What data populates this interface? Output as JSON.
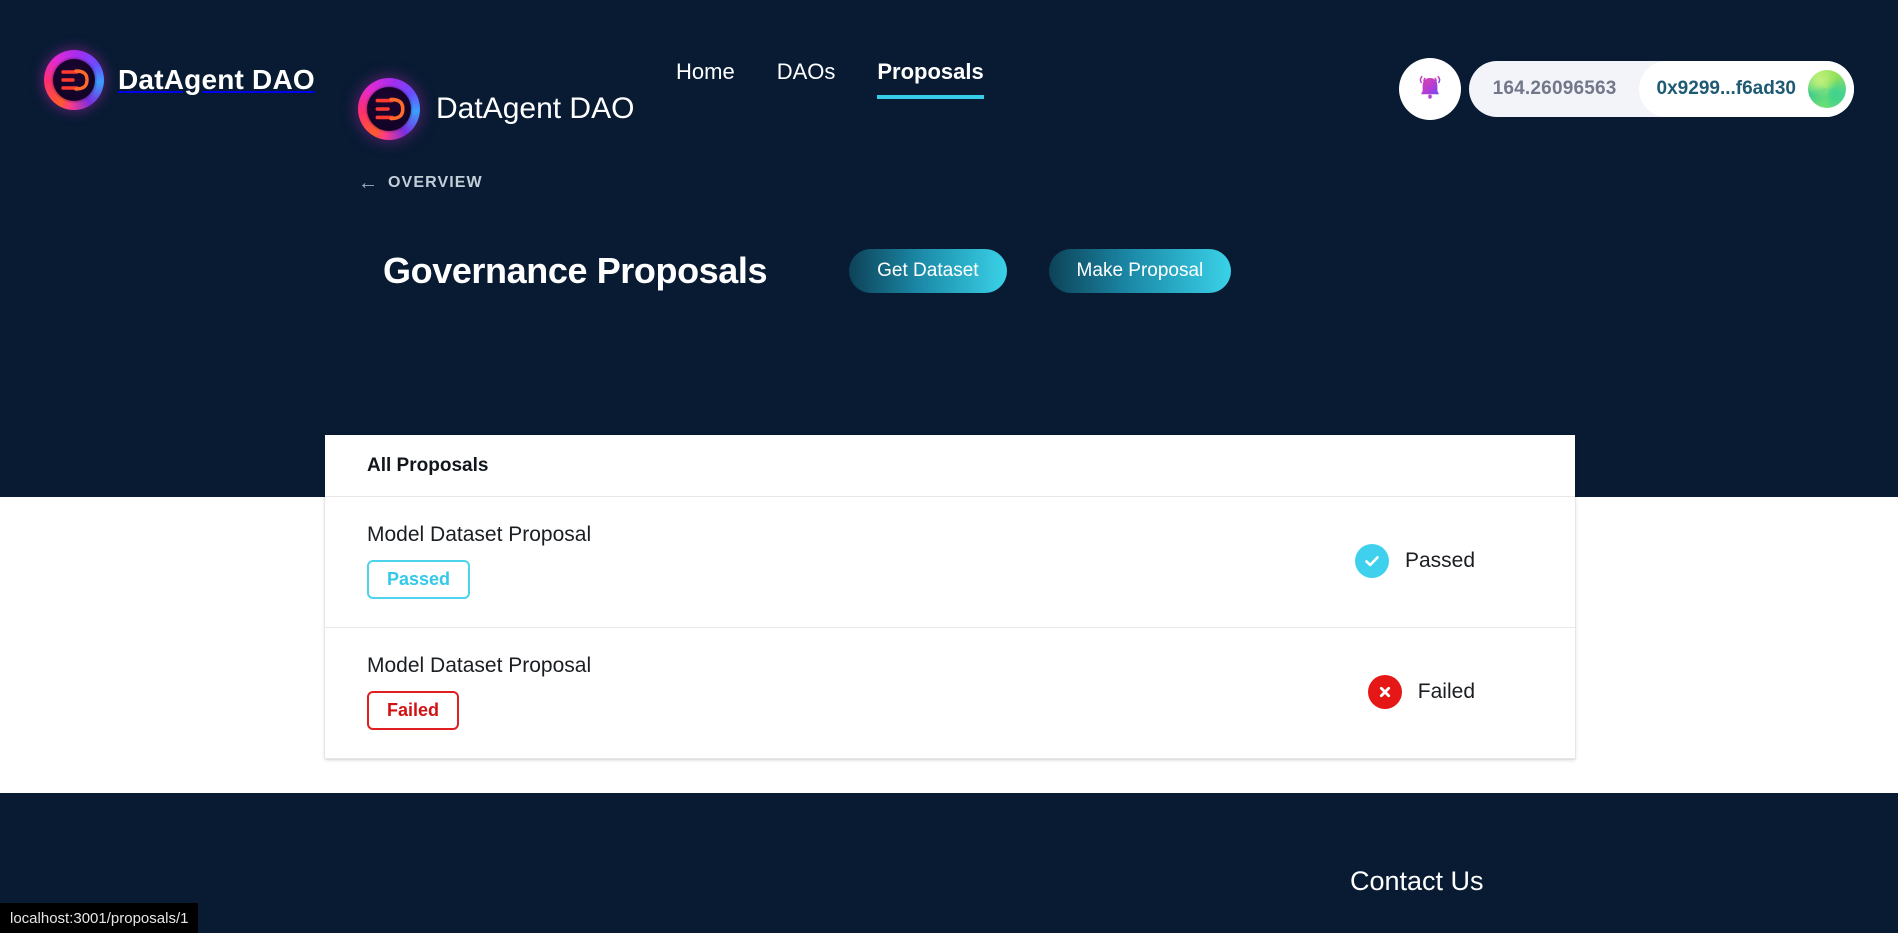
{
  "browser": {
    "status_url": "localhost:3001/proposals/1"
  },
  "navbar": {
    "brand_name": "DatAgent DAO",
    "logo_icon": "datagent-logo-icon",
    "links": [
      {
        "label": "Home",
        "active": false
      },
      {
        "label": "DAOs",
        "active": false
      },
      {
        "label": "Proposals",
        "active": true
      }
    ],
    "notification_icon": "bell-icon",
    "wallet": {
      "balance": "164.26096563",
      "address": "0x9299...f6ad30",
      "avatar_icon": "wallet-avatar-icon"
    }
  },
  "hero": {
    "breadcrumb": {
      "arrow_icon": "arrow-left-icon",
      "label": "OVERVIEW"
    },
    "title": "Governance Proposals",
    "buttons": [
      {
        "label": "Get Dataset"
      },
      {
        "label": "Make Proposal"
      }
    ]
  },
  "card": {
    "header_title": "All Proposals",
    "proposals": [
      {
        "title": "Model Dataset Proposal",
        "badge": "Passed",
        "result_label": "Passed",
        "result_icon": "check-circle-icon",
        "state": "passed"
      },
      {
        "title": "Model Dataset Proposal",
        "badge": "Failed",
        "result_label": "Failed",
        "result_icon": "x-circle-icon",
        "state": "failed"
      }
    ]
  },
  "footer": {
    "brand_name": "DatAgent DAO",
    "logo_icon": "datagent-logo-icon",
    "contact_title": "Contact Us"
  },
  "colors": {
    "hero_bg": "#081b33",
    "accent_cyan": "#35cdea",
    "passed": "#3fd0ed",
    "failed": "#e61717",
    "button_gradient_start": "#0d4258",
    "button_gradient_end": "#3ad2e8"
  }
}
